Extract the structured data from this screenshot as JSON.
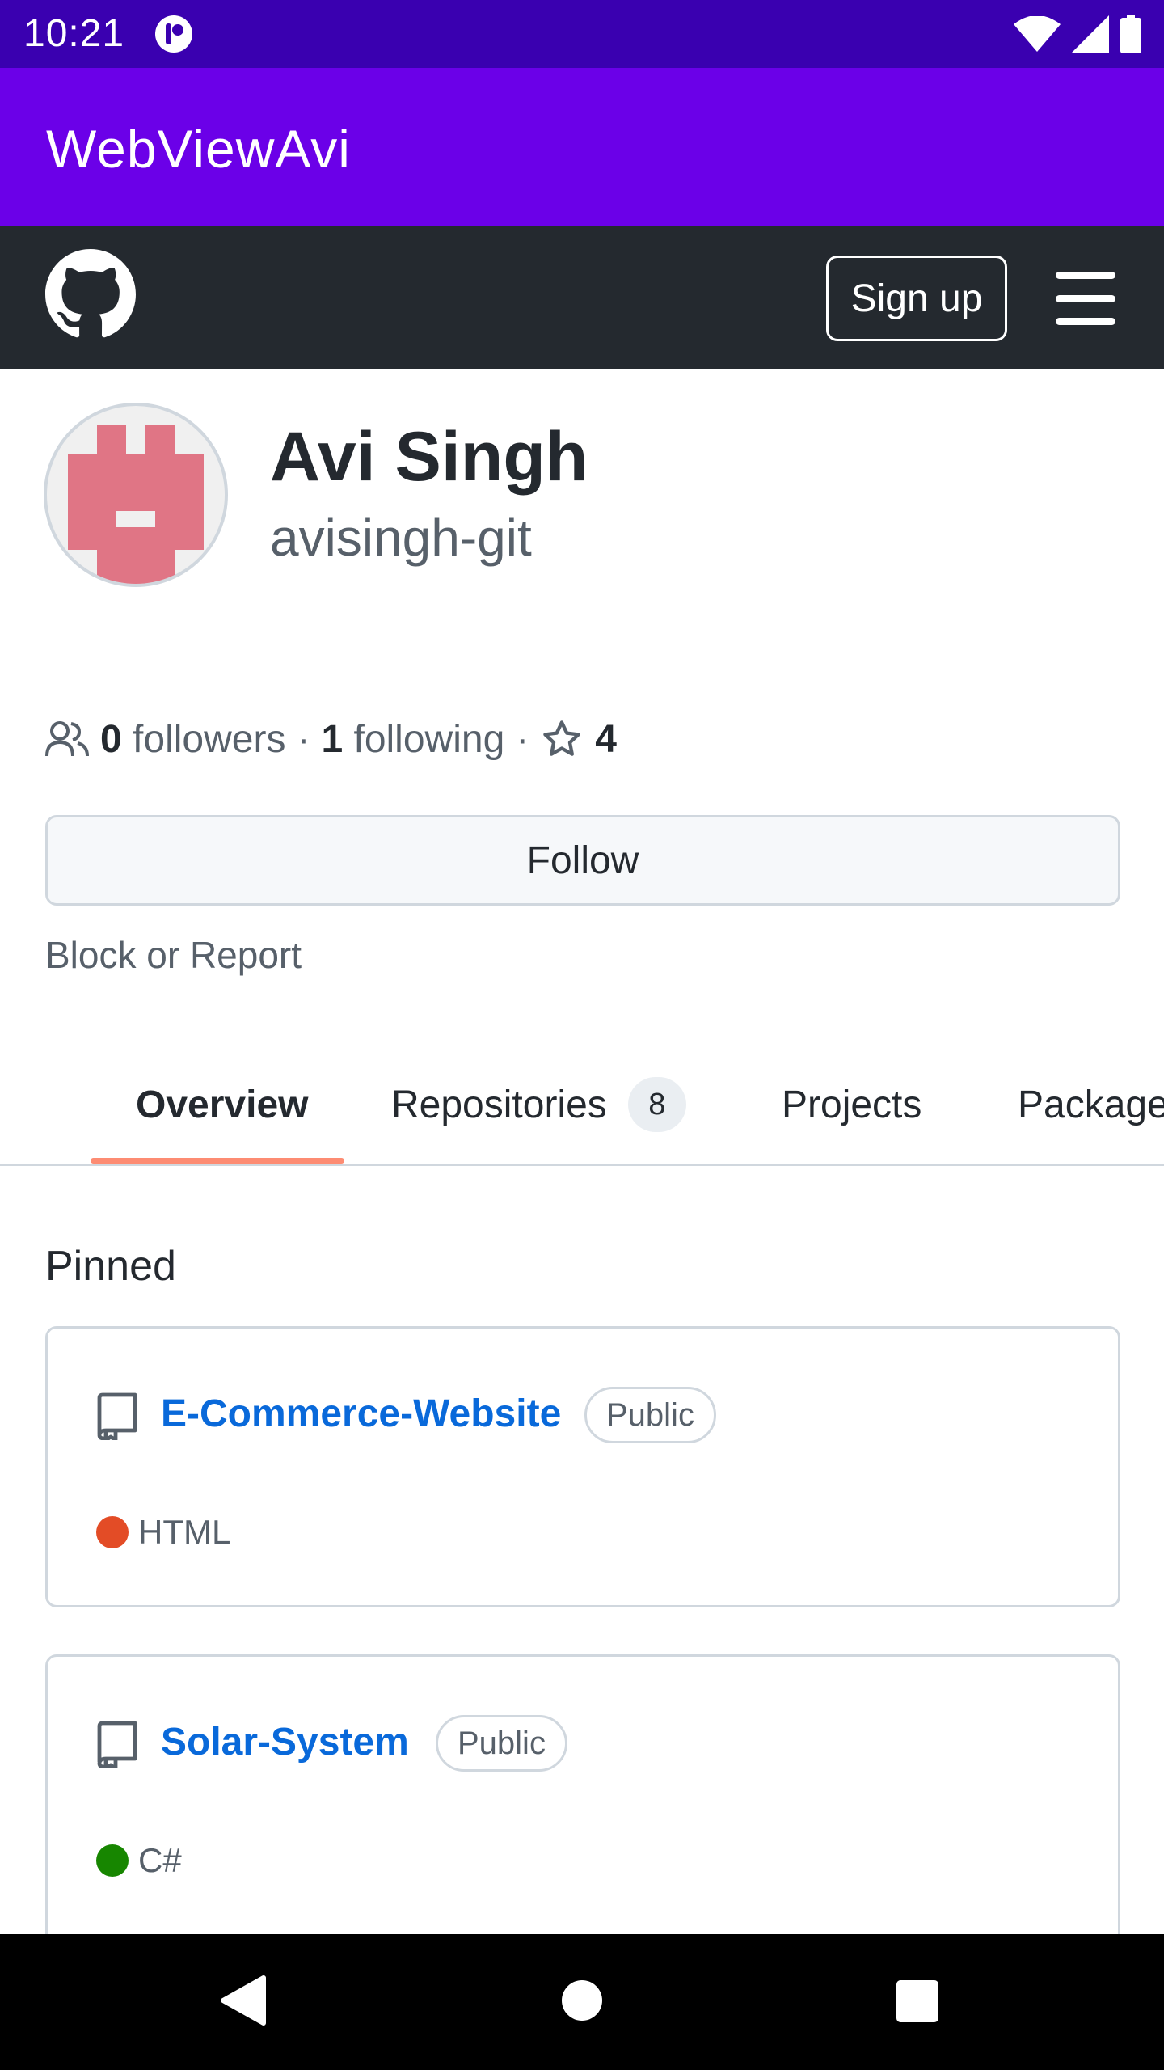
{
  "status_bar": {
    "time": "10:21",
    "icons": [
      "app-notification-icon",
      "wifi-icon",
      "cellular-signal-icon",
      "battery-icon"
    ]
  },
  "app_bar": {
    "title": "WebViewAvi"
  },
  "gh_header": {
    "logo": "github-icon",
    "signup_label": "Sign up",
    "menu_icon": "hamburger-menu-icon"
  },
  "profile": {
    "name": "Avi Singh",
    "login": "avisingh-git",
    "avatar_color": "#e07585"
  },
  "stats": {
    "followers_count": "0",
    "followers_label": "followers",
    "separator": "·",
    "following_count": "1",
    "following_label": "following",
    "stars_count": "4"
  },
  "actions": {
    "follow_label": "Follow",
    "block_label": "Block or Report"
  },
  "tabs": [
    {
      "label": "Overview",
      "active": true
    },
    {
      "label": "Repositories",
      "count": "8"
    },
    {
      "label": "Projects"
    },
    {
      "label": "Packages"
    }
  ],
  "pinned": {
    "title": "Pinned",
    "repos": [
      {
        "name": "E-Commerce-Website",
        "visibility": "Public",
        "language": "HTML",
        "language_color": "#e34c26"
      },
      {
        "name": "Solar-System",
        "visibility": "Public",
        "language": "C#",
        "language_color": "#178600"
      }
    ]
  },
  "colors": {
    "status_bar": "#3a00b0",
    "app_bar": "#6b00e8",
    "gh_header": "#24292f",
    "link": "#0969da",
    "tab_underline": "#fd8c73"
  }
}
